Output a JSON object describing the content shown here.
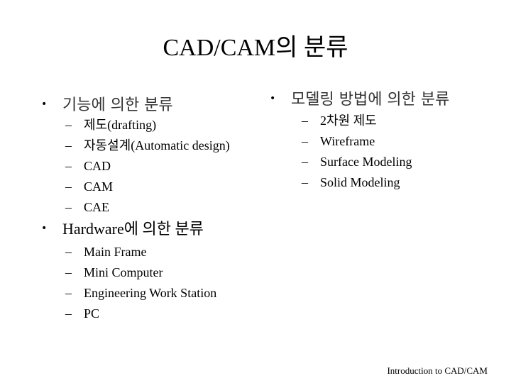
{
  "title": "CAD/CAM의 분류",
  "sections": [
    {
      "heading": "기능에 의한 분류",
      "items": [
        "제도(drafting)",
        "자동설계(Automatic design)",
        "CAD",
        "CAM",
        "CAE"
      ]
    },
    {
      "heading": "모델링 방법에 의한 분류",
      "items": [
        "2차원 제도",
        "Wireframe",
        "Surface Modeling",
        "Solid Modeling"
      ]
    },
    {
      "heading": "Hardware에 의한 분류",
      "items": [
        "Main Frame",
        "Mini Computer",
        "Engineering Work Station",
        "PC"
      ]
    }
  ],
  "bullet_glyph": "•",
  "dash_glyph": "–",
  "footer": "Introduction to CAD/CAM"
}
